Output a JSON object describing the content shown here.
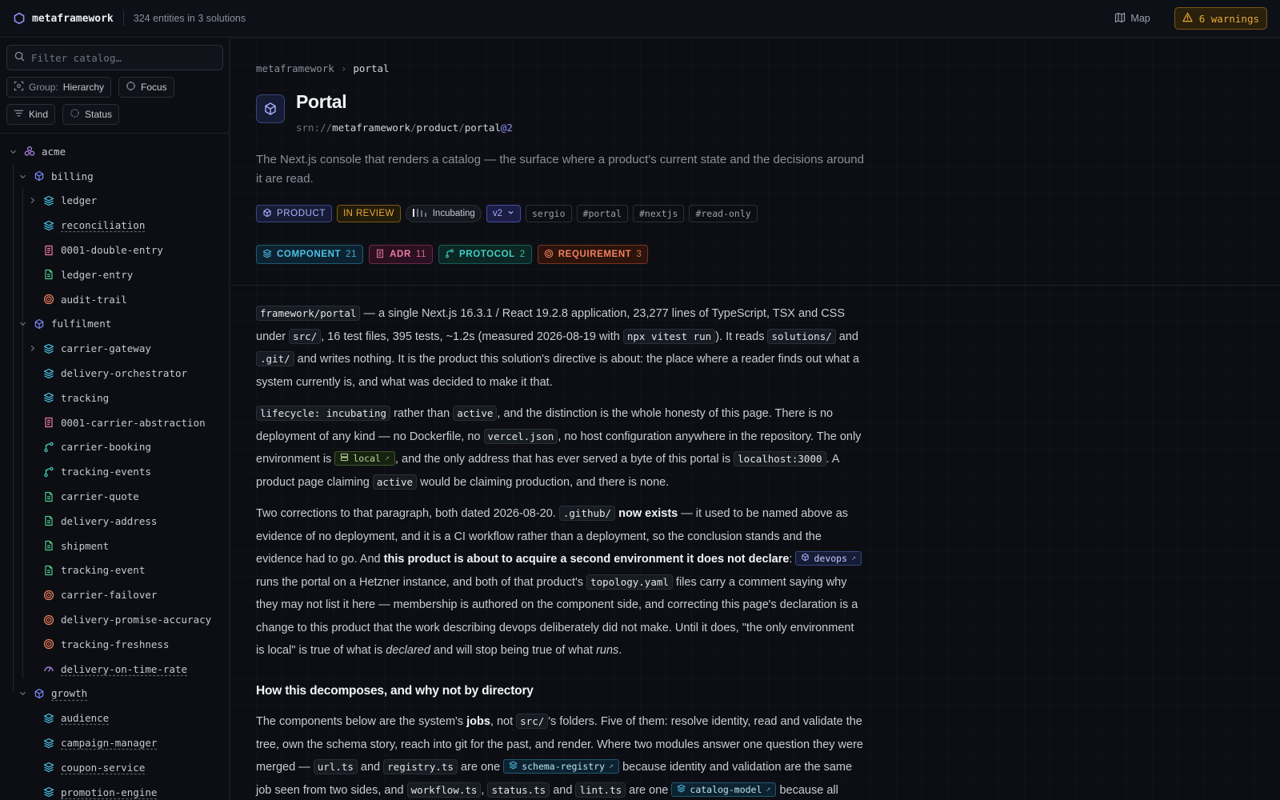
{
  "topbar": {
    "brand": "metaframework",
    "summary": "324 entities in 3 solutions",
    "map_label": "Map",
    "warnings_label": "6 warnings"
  },
  "sidebar": {
    "search_placeholder": "Filter catalog…",
    "group_label": "Group:",
    "group_value": "Hierarchy",
    "focus_label": "Focus",
    "kind_label": "Kind",
    "status_label": "Status",
    "tree": [
      {
        "label": "acme",
        "icon": "solution-icon",
        "depth": 0,
        "chevron": "down",
        "color": "#b48cf0"
      },
      {
        "label": "billing",
        "icon": "product-icon",
        "depth": 1,
        "chevron": "down",
        "color": "#7d8cff"
      },
      {
        "label": "ledger",
        "icon": "component-icon",
        "depth": 2,
        "chevron": "right",
        "color": "#4cc2e8"
      },
      {
        "label": "reconciliation",
        "icon": "component-icon",
        "depth": 2,
        "underline": true,
        "color": "#4cc2e8"
      },
      {
        "label": "0001-double-entry",
        "icon": "adr-icon",
        "depth": 2,
        "color": "#ee7aa8"
      },
      {
        "label": "ledger-entry",
        "icon": "schema-icon",
        "depth": 2,
        "color": "#4fc98a"
      },
      {
        "label": "audit-trail",
        "icon": "requirement-icon",
        "depth": 2,
        "color": "#f0805e"
      },
      {
        "label": "fulfilment",
        "icon": "product-icon",
        "depth": 1,
        "chevron": "down",
        "color": "#7d8cff"
      },
      {
        "label": "carrier-gateway",
        "icon": "component-icon",
        "depth": 2,
        "chevron": "right",
        "color": "#4cc2e8"
      },
      {
        "label": "delivery-orchestrator",
        "icon": "component-icon",
        "depth": 2,
        "color": "#4cc2e8"
      },
      {
        "label": "tracking",
        "icon": "component-icon",
        "depth": 2,
        "color": "#4cc2e8"
      },
      {
        "label": "0001-carrier-abstraction",
        "icon": "adr-icon",
        "depth": 2,
        "color": "#ee7aa8"
      },
      {
        "label": "carrier-booking",
        "icon": "protocol-icon",
        "depth": 2,
        "color": "#3fd0c0"
      },
      {
        "label": "tracking-events",
        "icon": "protocol-icon",
        "depth": 2,
        "color": "#3fd0c0"
      },
      {
        "label": "carrier-quote",
        "icon": "schema-icon",
        "depth": 2,
        "color": "#4fc98a"
      },
      {
        "label": "delivery-address",
        "icon": "schema-icon",
        "depth": 2,
        "color": "#4fc98a"
      },
      {
        "label": "shipment",
        "icon": "schema-icon",
        "depth": 2,
        "color": "#4fc98a"
      },
      {
        "label": "tracking-event",
        "icon": "schema-icon",
        "depth": 2,
        "color": "#4fc98a"
      },
      {
        "label": "carrier-failover",
        "icon": "requirement-icon",
        "depth": 2,
        "color": "#f0805e"
      },
      {
        "label": "delivery-promise-accuracy",
        "icon": "requirement-icon",
        "depth": 2,
        "color": "#f0805e"
      },
      {
        "label": "tracking-freshness",
        "icon": "requirement-icon",
        "depth": 2,
        "color": "#f0805e"
      },
      {
        "label": "delivery-on-time-rate",
        "icon": "metric-icon",
        "depth": 2,
        "underline": true,
        "color": "#b48cf0"
      },
      {
        "label": "growth",
        "icon": "product-icon",
        "depth": 1,
        "chevron": "down",
        "underline": true,
        "color": "#7d8cff"
      },
      {
        "label": "audience",
        "icon": "component-icon",
        "depth": 2,
        "underline": true,
        "color": "#4cc2e8"
      },
      {
        "label": "campaign-manager",
        "icon": "component-icon",
        "depth": 2,
        "underline": true,
        "color": "#4cc2e8"
      },
      {
        "label": "coupon-service",
        "icon": "component-icon",
        "depth": 2,
        "underline": true,
        "color": "#4cc2e8"
      },
      {
        "label": "promotion-engine",
        "icon": "component-icon",
        "depth": 2,
        "underline": true,
        "color": "#4cc2e8"
      }
    ]
  },
  "main": {
    "breadcrumb": [
      "metaframework",
      "portal"
    ],
    "title": "Portal",
    "srn": {
      "prefix": "srn://",
      "solution": "metaframework",
      "kind": "product",
      "name": "portal",
      "version": "@2"
    },
    "description": "The Next.js console that renders a catalog — the surface where a product's current state and the decisions around it are read.",
    "chips": {
      "kind": "PRODUCT",
      "status": "IN REVIEW",
      "lifecycle": "Incubating",
      "version": "v2",
      "owner": "sergio",
      "tags": [
        "#portal",
        "#nextjs",
        "#read-only"
      ]
    },
    "counts": [
      {
        "label": "COMPONENT",
        "count": "21"
      },
      {
        "label": "ADR",
        "count": "11"
      },
      {
        "label": "PROTOCOL",
        "count": "2"
      },
      {
        "label": "REQUIREMENT",
        "count": "3"
      }
    ],
    "heading": "How this decomposes, and why not by directory"
  },
  "colors": {
    "accent": "#7d8cff",
    "warning": "#e6a93a",
    "component": "#4cc2e8",
    "adr": "#ee7aa8",
    "protocol": "#3fd0c0",
    "requirement": "#f0805e"
  }
}
